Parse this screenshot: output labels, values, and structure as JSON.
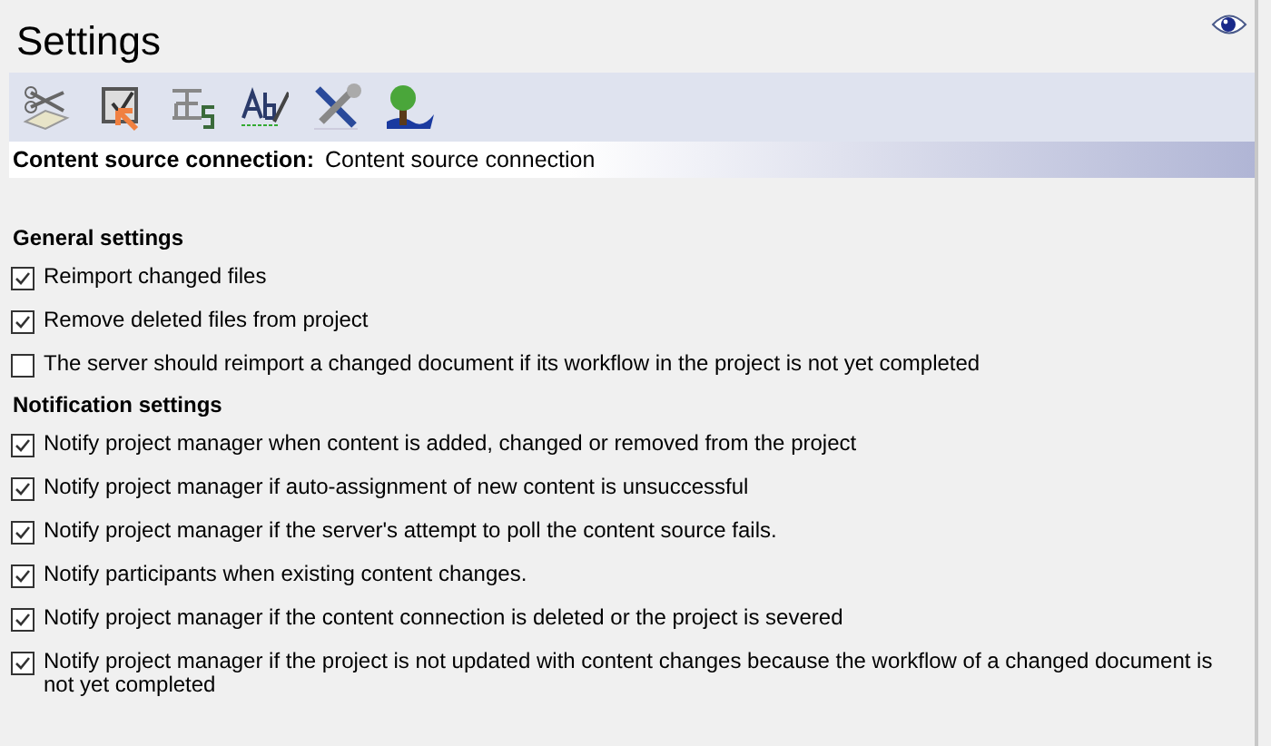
{
  "title": "Settings",
  "toolbar": {
    "icons": [
      {
        "kind": "scissors"
      },
      {
        "kind": "checkbox"
      },
      {
        "kind": "glyph"
      },
      {
        "kind": "spelling"
      },
      {
        "kind": "tools"
      },
      {
        "kind": "tree"
      }
    ]
  },
  "connection": {
    "label": "Content source connection:",
    "value": "Content source connection"
  },
  "sections": [
    {
      "heading": "General settings",
      "options": [
        {
          "label": "Reimport changed files",
          "checked": true
        },
        {
          "label": "Remove deleted files from project",
          "checked": true
        },
        {
          "label": "The server should reimport a changed document if its workflow in the project is not yet completed",
          "checked": false
        }
      ]
    },
    {
      "heading": "Notification settings",
      "options": [
        {
          "label": "Notify project manager when content is added, changed or removed from the project",
          "checked": true
        },
        {
          "label": "Notify project manager if auto-assignment of new content is unsuccessful",
          "checked": true
        },
        {
          "label": "Notify project manager if the server's attempt to poll the content source fails.",
          "checked": true
        },
        {
          "label": "Notify participants when existing content changes.",
          "checked": true
        },
        {
          "label": "Notify project manager if the content connection is deleted or the project is severed",
          "checked": true
        },
        {
          "label": "Notify project manager if the project is not updated with content changes because the workflow of a changed document is not yet completed",
          "checked": true
        }
      ]
    }
  ]
}
